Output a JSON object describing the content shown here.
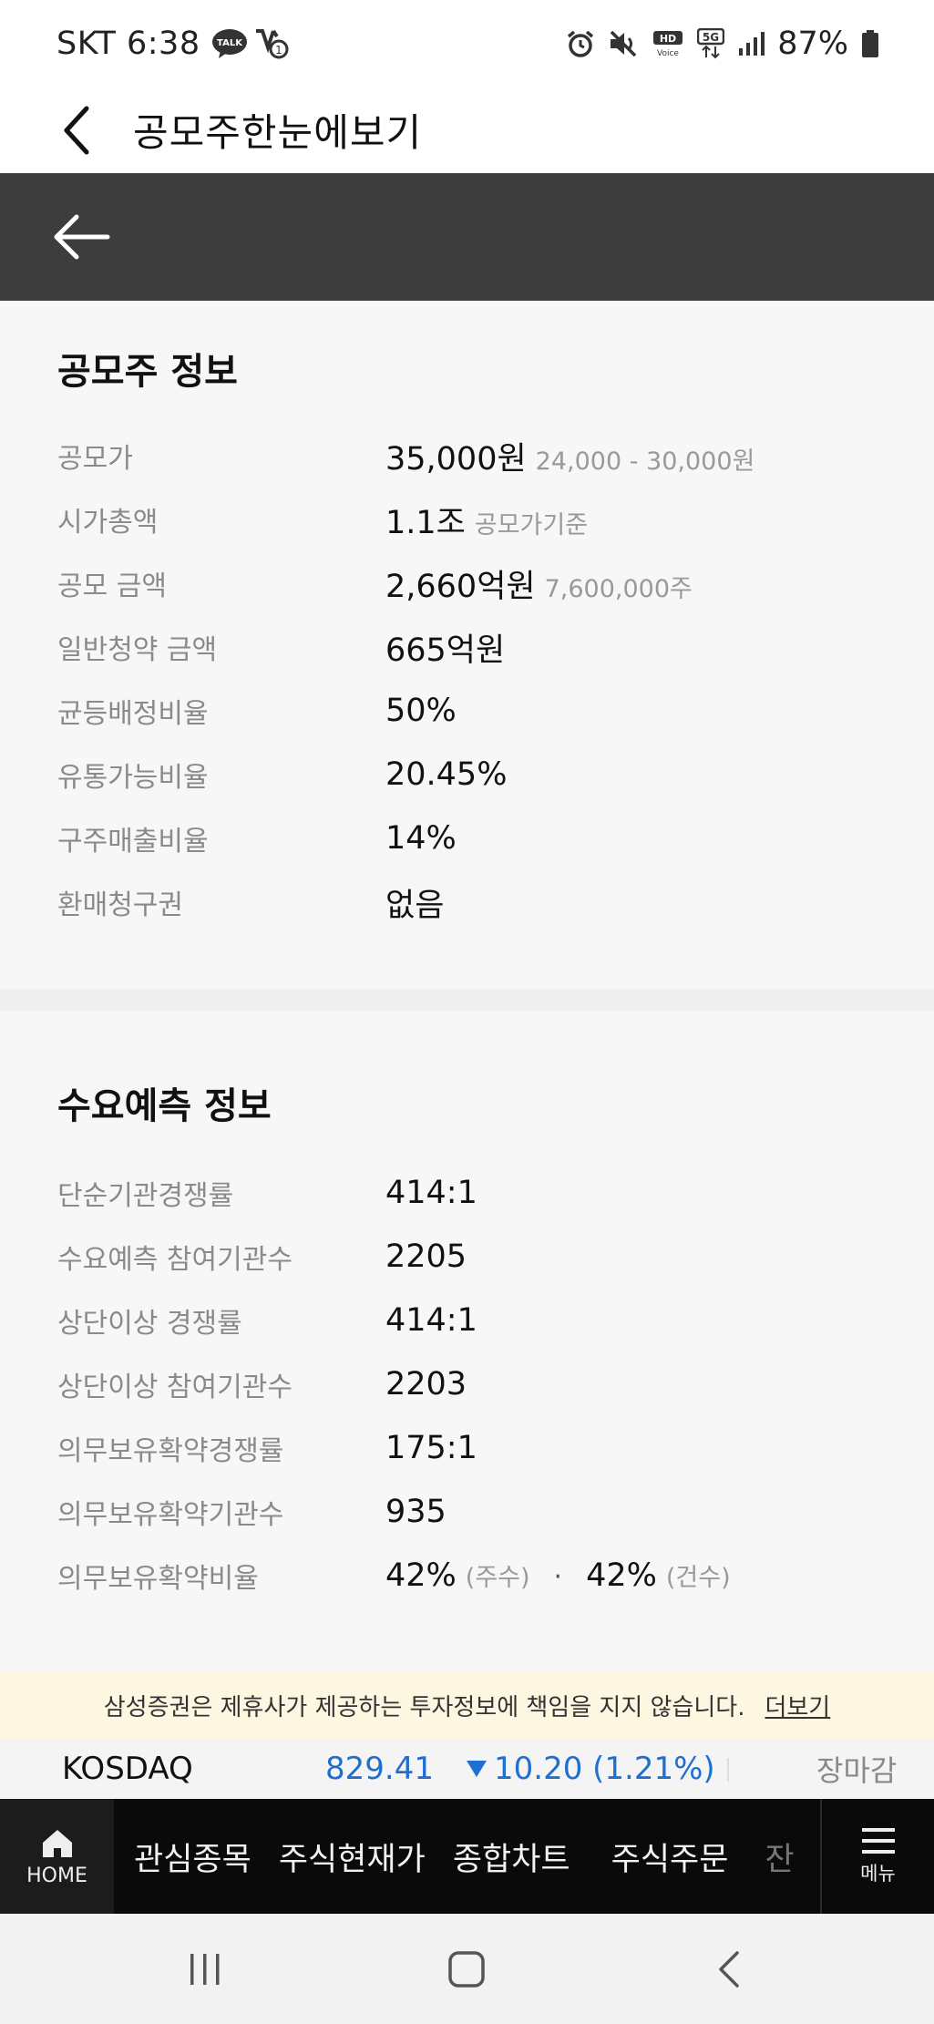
{
  "status_bar": {
    "carrier": "SKT",
    "time": "6:38",
    "talk_badge": "TALK",
    "battery": "87%"
  },
  "header": {
    "title": "공모주한눈에보기"
  },
  "ipo_info": {
    "title": "공모주 정보",
    "rows": [
      {
        "label": "공모가",
        "value": "35,000원",
        "sub": "24,000 - 30,000원"
      },
      {
        "label": "시가총액",
        "value": "1.1조",
        "sub": "공모가기준"
      },
      {
        "label": "공모 금액",
        "value": "2,660억원",
        "sub": "7,600,000주"
      },
      {
        "label": "일반청약 금액",
        "value": "665억원"
      },
      {
        "label": "균등배정비율",
        "value": "50%"
      },
      {
        "label": "유통가능비율",
        "value": "20.45%"
      },
      {
        "label": "구주매출비율",
        "value": "14%"
      },
      {
        "label": "환매청구권",
        "value": "없음"
      }
    ]
  },
  "demand_info": {
    "title": "수요예측 정보",
    "rows": [
      {
        "label": "단순기관경쟁률",
        "value": "414:1"
      },
      {
        "label": "수요예측 참여기관수",
        "value": "2205"
      },
      {
        "label": "상단이상 경쟁률",
        "value": "414:1"
      },
      {
        "label": "상단이상 참여기관수",
        "value": "2203"
      },
      {
        "label": "의무보유확약경쟁률",
        "value": "175:1"
      },
      {
        "label": "의무보유확약기관수",
        "value": "935"
      }
    ],
    "lockup_ratio": {
      "label": "의무보유확약비율",
      "value1": "42%",
      "sub1": "(주수)",
      "dot": "·",
      "value2": "42%",
      "sub2": "(건수)"
    }
  },
  "disclaimer": {
    "text": "삼성증권은 제휴사가 제공하는 투자정보에 책임을 지지 않습니다.",
    "more": "더보기"
  },
  "ticker": {
    "name": "KOSDAQ",
    "value": "829.41",
    "change": "10.20 (1.21%)",
    "status": "장마감",
    "color": "#1f6fd1"
  },
  "bottom_nav": {
    "home": "HOME",
    "items": [
      "관심종목",
      "주식현재가",
      "종합차트",
      "주식주문",
      "잔"
    ],
    "menu": "메뉴"
  },
  "icons": {
    "status_left": [
      "talk-icon",
      "notification-icon"
    ],
    "status_right": [
      "alarm-icon",
      "mute-icon",
      "hd-voice-icon",
      "5g-icon",
      "signal-icon",
      "battery-icon"
    ],
    "header_back": "chevron-left-icon",
    "dark_back": "arrow-left-icon"
  }
}
